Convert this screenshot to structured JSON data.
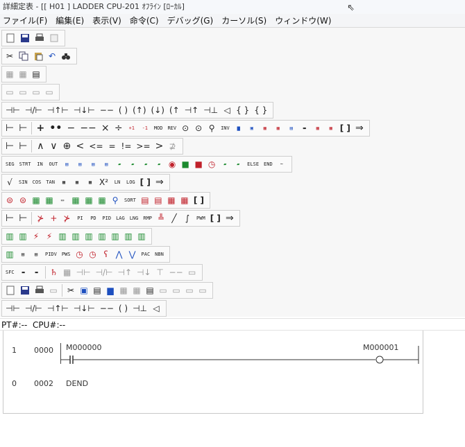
{
  "window": {
    "title": "詳細定表 - [[ H01 ] LADDER      CPU-201    ｵﾌﾗｲﾝ [ﾛｰｶﾙ]",
    "cursor_icon": "mouse-cursor-icon"
  },
  "menu": [
    "ファイル(F)",
    "編集(E)",
    "表示(V)",
    "命令(C)",
    "デバッグ(G)",
    "カーソル(S)",
    "ウィンドウ(W)"
  ],
  "toolbars": {
    "t9": [
      "⊣⊢",
      "⊣/⊢",
      "⊣↑⊢",
      "⊣↓⊢",
      "−−",
      "( )",
      "(↑)",
      "(↓)",
      "(↑",
      "⊣↑",
      "⊣⊥",
      "◁",
      "{ }",
      "{ }"
    ],
    "t10": [
      "⊢",
      "⊢",
      "+",
      "••",
      "−",
      "−−",
      "×",
      "÷",
      "+1",
      "-1",
      "MOD",
      "REV",
      "⊙",
      "⊙",
      "⚲",
      "INV",
      "",
      "",
      "",
      "",
      "",
      "",
      "[ ]",
      "⇒"
    ],
    "t11": [
      "⊢",
      "⊢",
      "∧",
      "∨",
      "⊕",
      "<",
      "<=",
      "=",
      "!=",
      ">=",
      ">",
      "⊉"
    ],
    "t12": [
      "SEG",
      "STRT",
      "IN",
      "OUT",
      "",
      "",
      "",
      "",
      "",
      "",
      "",
      "",
      "",
      "",
      "",
      "",
      "",
      "",
      "ELSE",
      "END",
      "~"
    ],
    "t13": [
      "√",
      "SIN",
      "COS",
      "TAN",
      "",
      "",
      "",
      "X²",
      "LN",
      "LOG",
      "[ ]",
      "⇒"
    ],
    "t14": [
      "",
      "",
      "",
      "",
      "",
      "",
      "",
      "",
      "SORT",
      "",
      "",
      "",
      "",
      "[ ]"
    ],
    "t15": [
      "⊢",
      "⊢",
      "⊁",
      "+",
      "⊁",
      "PI",
      "PD",
      "PID",
      "LAG",
      "LNG",
      "RMP",
      "",
      "╱",
      "∫",
      "PWM",
      "[ ]",
      "⇒"
    ],
    "t16": [
      "",
      "",
      "",
      "",
      "",
      "",
      "",
      "",
      "",
      "",
      ""
    ],
    "t17": [
      "",
      "",
      "",
      "PIDV",
      "PWS",
      "",
      "",
      "",
      "",
      "",
      "PAC",
      "NBN"
    ],
    "t18": [
      "SFC",
      "",
      "",
      "",
      "",
      "",
      "",
      "",
      "",
      "",
      "",
      "",
      ""
    ],
    "t20": [
      "⊣⊢",
      "⊣/⊢",
      "⊣↑⊢",
      "⊣↓⊢",
      "−−",
      "( )",
      "⊣⊥",
      "◁"
    ]
  },
  "status": {
    "pt_label": "PT#:",
    "pt_value": "--",
    "cpu_label": "CPU#:",
    "cpu_value": "--"
  },
  "ladder": {
    "rows": [
      {
        "num": "1",
        "addr": "0000",
        "contact": "M000000",
        "coil": "M000001"
      },
      {
        "num": "0",
        "addr": "0002",
        "instr": "DEND"
      }
    ]
  },
  "colors": {
    "menubar_bg": "#f4f5f7",
    "toolbar_bg": "#fafafa",
    "red_icon": "#c0202a",
    "green_icon": "#1b8a2e",
    "blue_icon": "#1d4fbf"
  }
}
